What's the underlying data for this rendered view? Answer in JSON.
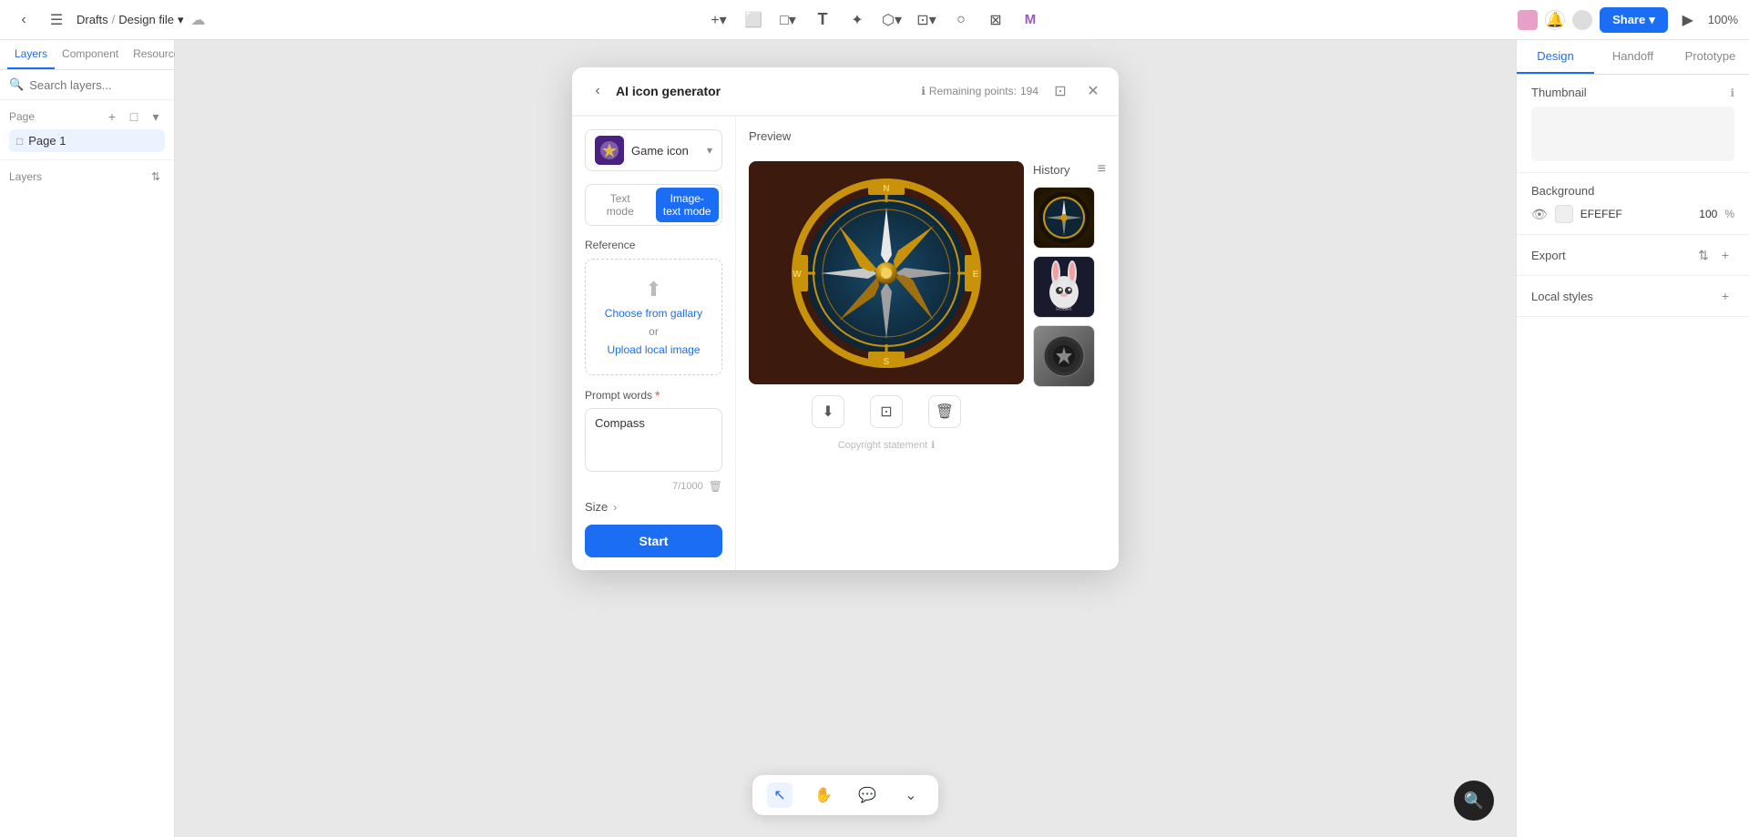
{
  "app": {
    "title": "Design file",
    "drafts": "Drafts",
    "separator": "/",
    "zoom": "100%"
  },
  "toolbar": {
    "back_label": "‹",
    "menu_label": "☰",
    "add_label": "+",
    "frame_label": "⬜",
    "rect_label": "□",
    "text_label": "T",
    "pen_label": "✦",
    "component_label": "⬡",
    "mask_label": "⊡",
    "shape_label": "○",
    "crop_label": "⊠",
    "brand_label": "M",
    "share_label": "Share",
    "play_label": "▶",
    "search_label": "🔍",
    "notification_label": "🔔",
    "user_label": "👤"
  },
  "left_panel": {
    "tabs": [
      "Layers",
      "Component",
      "Resource"
    ],
    "active_tab": "Layers",
    "search_placeholder": "Search layers...",
    "page_section_label": "Page",
    "pages": [
      {
        "name": "Page 1",
        "icon": "□"
      }
    ],
    "layers_label": "Layers"
  },
  "right_panel": {
    "tabs": [
      "Design",
      "Handoff",
      "Prototype"
    ],
    "active_tab": "Design",
    "thumbnail_label": "Thumbnail",
    "background_label": "Background",
    "bg_color": "EFEFEF",
    "bg_opacity": "100",
    "bg_opacity_pct": "%",
    "export_label": "Export",
    "local_styles_label": "Local styles"
  },
  "modal": {
    "title": "AI icon generator",
    "remaining_points_label": "Remaining points:",
    "remaining_points": "194",
    "style_name": "Game icon",
    "mode_tabs": [
      "Text mode",
      "Image-text mode"
    ],
    "active_mode": "Image-text mode",
    "reference_label": "Reference",
    "upload_link": "Choose from gallary",
    "upload_or": "or",
    "upload_local": "Upload local image",
    "prompt_label": "Prompt words",
    "prompt_value": "Compass",
    "char_count": "7/1000",
    "size_label": "Size",
    "start_label": "Start",
    "preview_label": "Preview",
    "history_label": "History",
    "copyright_label": "Copyright statement"
  },
  "bottom_toolbar": {
    "tools": [
      {
        "name": "cursor",
        "icon": "↖",
        "active": true
      },
      {
        "name": "hand",
        "icon": "✋",
        "active": false
      },
      {
        "name": "comment",
        "icon": "💬",
        "active": false
      },
      {
        "name": "more",
        "icon": "⌄",
        "active": false
      }
    ]
  }
}
